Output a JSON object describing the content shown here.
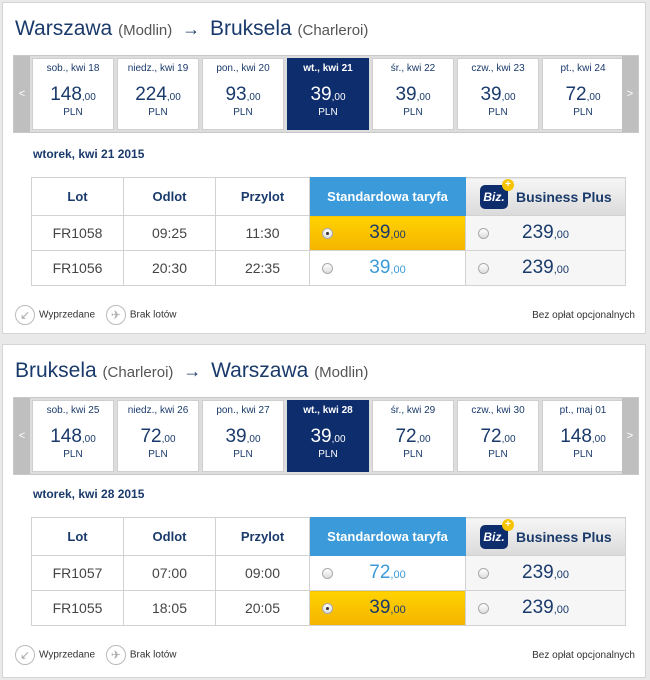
{
  "outbound": {
    "from_city": "Warszawa",
    "from_airport": "(Modlin)",
    "arrow": "→",
    "to_city": "Bruksela",
    "to_airport": "(Charleroi)",
    "nav_prev": "<",
    "nav_next": ">",
    "days": [
      {
        "label": "sob., kwi 18",
        "price": "148",
        "dec": ",00",
        "cur": "PLN"
      },
      {
        "label": "niedz., kwi 19",
        "price": "224",
        "dec": ",00",
        "cur": "PLN"
      },
      {
        "label": "pon., kwi 20",
        "price": "93",
        "dec": ",00",
        "cur": "PLN"
      },
      {
        "label": "wt., kwi 21",
        "price": "39",
        "dec": ",00",
        "cur": "PLN"
      },
      {
        "label": "śr., kwi 22",
        "price": "39",
        "dec": ",00",
        "cur": "PLN"
      },
      {
        "label": "czw., kwi 23",
        "price": "39",
        "dec": ",00",
        "cur": "PLN"
      },
      {
        "label": "pt., kwi 24",
        "price": "72",
        "dec": ",00",
        "cur": "PLN"
      }
    ],
    "selected_day_index": 3,
    "date_heading": "wtorek, kwi 21 2015",
    "headers": {
      "flight": "Lot",
      "depart": "Odlot",
      "arrive": "Przylot",
      "standard": "Standardowa taryfa",
      "biz_badge": "Biz.",
      "biz_plus": "+",
      "business": "Business Plus"
    },
    "flights": [
      {
        "number": "FR1058",
        "depart": "09:25",
        "arrive": "11:30",
        "std_price": "39",
        "std_dec": ",00",
        "biz_price": "239",
        "biz_dec": ",00",
        "std_selected": true
      },
      {
        "number": "FR1056",
        "depart": "20:30",
        "arrive": "22:35",
        "std_price": "39",
        "std_dec": ",00",
        "biz_price": "239",
        "biz_dec": ",00",
        "std_selected": false
      }
    ],
    "legend_sold": "Wyprzedane",
    "legend_none": "Brak lotów",
    "optional_fees": "Bez opłat opcjonalnych"
  },
  "return": {
    "from_city": "Bruksela",
    "from_airport": "(Charleroi)",
    "arrow": "→",
    "to_city": "Warszawa",
    "to_airport": "(Modlin)",
    "nav_prev": "<",
    "nav_next": ">",
    "days": [
      {
        "label": "sob., kwi 25",
        "price": "148",
        "dec": ",00",
        "cur": "PLN"
      },
      {
        "label": "niedz., kwi 26",
        "price": "72",
        "dec": ",00",
        "cur": "PLN"
      },
      {
        "label": "pon., kwi 27",
        "price": "39",
        "dec": ",00",
        "cur": "PLN"
      },
      {
        "label": "wt., kwi 28",
        "price": "39",
        "dec": ",00",
        "cur": "PLN"
      },
      {
        "label": "śr., kwi 29",
        "price": "72",
        "dec": ",00",
        "cur": "PLN"
      },
      {
        "label": "czw., kwi 30",
        "price": "72",
        "dec": ",00",
        "cur": "PLN"
      },
      {
        "label": "pt., maj 01",
        "price": "148",
        "dec": ",00",
        "cur": "PLN"
      }
    ],
    "selected_day_index": 3,
    "date_heading": "wtorek, kwi 28 2015",
    "headers": {
      "flight": "Lot",
      "depart": "Odlot",
      "arrive": "Przylot",
      "standard": "Standardowa taryfa",
      "biz_badge": "Biz.",
      "biz_plus": "+",
      "business": "Business Plus"
    },
    "flights": [
      {
        "number": "FR1057",
        "depart": "07:00",
        "arrive": "09:00",
        "std_price": "72",
        "std_dec": ",00",
        "biz_price": "239",
        "biz_dec": ",00",
        "std_selected": false
      },
      {
        "number": "FR1055",
        "depart": "18:05",
        "arrive": "20:05",
        "std_price": "39",
        "std_dec": ",00",
        "biz_price": "239",
        "biz_dec": ",00",
        "std_selected": true
      }
    ],
    "legend_sold": "Wyprzedane",
    "legend_none": "Brak lotów",
    "optional_fees": "Bez opłat opcjonalnych"
  },
  "colors": {
    "brand_navy": "#0d2d6c",
    "standard_blue": "#3b9ad9",
    "selected_yellow": "#ffd200"
  },
  "icons": {
    "sold_out": "sold-out-icon",
    "no_flights": "no-flights-icon",
    "prev": "chevron-left-icon",
    "next": "chevron-right-icon"
  }
}
